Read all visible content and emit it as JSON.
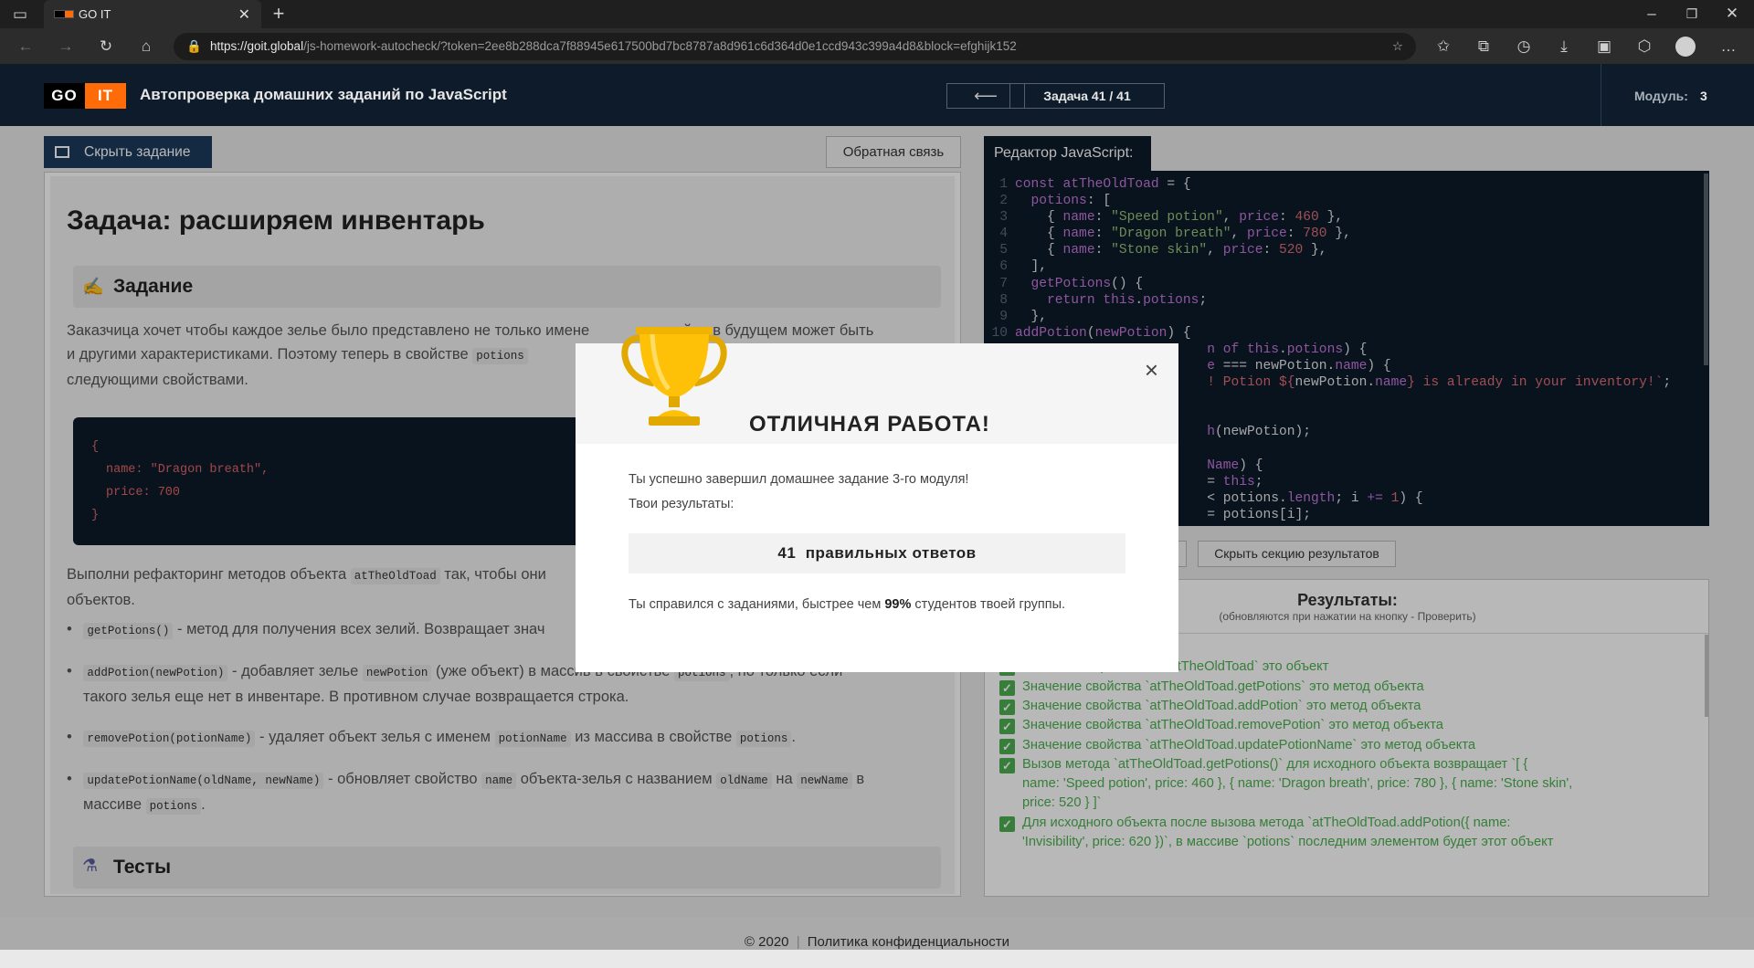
{
  "browser": {
    "tab_title": "GO IT",
    "url_host": "https://goit.global",
    "url_path": "/js-homework-autocheck/?token=2ee8b288dca7f88945e617500bd7bc8787a8d961c6d364d0e1ccd943c399a4d8&block=efghijk152"
  },
  "header": {
    "logo_go": "GO",
    "logo_it": "IT",
    "title": "Автопроверка домашних заданий по JavaScript",
    "back_arrow": "⟵",
    "task_counter": "Задача 41 / 41",
    "module_label": "Модуль:",
    "module_value": "3"
  },
  "toolbar": {
    "hide_task": "Скрыть задание",
    "feedback": "Обратная связь",
    "editor_title": "Редактор JavaScript:",
    "hide_results": "Скрыть секцию результатов"
  },
  "task": {
    "heading": "Задача: расширяем инвентарь",
    "section_assignment": "Задание",
    "p1_line1_a": "Заказчица хочет чтобы каждое зелье было представлено не только имене",
    "p1_line1_b": "ной, а в будущем может быть",
    "p1_line2": "и другими характеристиками. Поэтому теперь в свойстве",
    "p1_line2_code": "potions",
    "p1_line3": "следующими свойствами.",
    "code_open": "{",
    "code_name": "name: \"Dragon breath\",",
    "code_price": "price: 700",
    "code_close": "}",
    "p2_line1_a": "Выполни рефакторинг методов объекта",
    "p2_line1_code": "atTheOldToad",
    "p2_line1_b": "так, чтобы они",
    "p2_line2": "объектов.",
    "li1_code": "getPotions()",
    "li1_text": "- метод для получения всех зелий. Возвращает знач",
    "li2_code": "addPotion(newPotion)",
    "li2_text_a": "- добавляет зелье",
    "li2_code2": "newPotion",
    "li2_text_b": "(уже объект) в массив в свойстве",
    "li2_code3": "potions",
    "li2_text_c": ", но только если",
    "li2_line2": "такого зелья еще нет в инвентаре. В противном случае возвращается строка.",
    "li3_code": "removePotion(potionName)",
    "li3_text_a": "- удаляет объект зелья с именем",
    "li3_code2": "potionName",
    "li3_text_b": "из массива в свойстве",
    "li3_code3": "potions",
    "li3_text_c": ".",
    "li4_code": "updatePotionName(oldName, newName)",
    "li4_text_a": "- обновляет свойство",
    "li4_code2": "name",
    "li4_text_b": "объекта-зелья с названием",
    "li4_code3": "oldName",
    "li4_text_c": "на",
    "li4_code4": "newName",
    "li4_text_d": "в",
    "li4_line2_a": "массиве",
    "li4_line2_code": "potions",
    "li4_line2_b": ".",
    "section_tests": "Тесты"
  },
  "editor": {
    "lines": [
      {
        "n": "1",
        "parts": [
          [
            "kw",
            "const "
          ],
          [
            "nm",
            "atTheOldToad"
          ],
          [
            "txt",
            " = {"
          ]
        ]
      },
      {
        "n": "2",
        "parts": [
          [
            "pr",
            "  potions"
          ],
          [
            "txt",
            ": ["
          ]
        ]
      },
      {
        "n": "3",
        "parts": [
          [
            "txt",
            "    { "
          ],
          [
            "pr",
            "name"
          ],
          [
            "txt",
            ": "
          ],
          [
            "str",
            "\"Speed potion\""
          ],
          [
            "txt",
            ", "
          ],
          [
            "pr",
            "price"
          ],
          [
            "txt",
            ": "
          ],
          [
            "num",
            "460"
          ],
          [
            "txt",
            " },"
          ]
        ]
      },
      {
        "n": "4",
        "parts": [
          [
            "txt",
            "    { "
          ],
          [
            "pr",
            "name"
          ],
          [
            "txt",
            ": "
          ],
          [
            "str",
            "\"Dragon breath\""
          ],
          [
            "txt",
            ", "
          ],
          [
            "pr",
            "price"
          ],
          [
            "txt",
            ": "
          ],
          [
            "num",
            "780"
          ],
          [
            "txt",
            " },"
          ]
        ]
      },
      {
        "n": "5",
        "parts": [
          [
            "txt",
            "    { "
          ],
          [
            "pr",
            "name"
          ],
          [
            "txt",
            ": "
          ],
          [
            "str",
            "\"Stone skin\""
          ],
          [
            "txt",
            ", "
          ],
          [
            "pr",
            "price"
          ],
          [
            "txt",
            ": "
          ],
          [
            "num",
            "520"
          ],
          [
            "txt",
            " },"
          ]
        ]
      },
      {
        "n": "6",
        "parts": [
          [
            "txt",
            "  ],"
          ]
        ]
      },
      {
        "n": "7",
        "parts": [
          [
            "pr",
            "  getPotions"
          ],
          [
            "txt",
            "() {"
          ]
        ]
      },
      {
        "n": "8",
        "parts": [
          [
            "kw",
            "    return "
          ],
          [
            "kw",
            "this"
          ],
          [
            "txt",
            "."
          ],
          [
            "pr",
            "potions"
          ],
          [
            "txt",
            ";"
          ]
        ]
      },
      {
        "n": "9",
        "parts": [
          [
            "txt",
            "  },"
          ]
        ]
      },
      {
        "n": "10",
        "parts": [
          [
            "pr",
            "addPotion"
          ],
          [
            "txt",
            "("
          ],
          [
            "pr",
            "newPotion"
          ],
          [
            "txt",
            ") {"
          ]
        ]
      },
      {
        "n": "",
        "parts": [
          [
            "txt",
            "                        "
          ],
          [
            "kw",
            "n of "
          ],
          [
            "kw",
            "this"
          ],
          [
            "txt",
            "."
          ],
          [
            "pr",
            "potions"
          ],
          [
            "txt",
            ") {"
          ]
        ]
      },
      {
        "n": "",
        "parts": [
          [
            "txt",
            "                        "
          ],
          [
            "pr",
            "e"
          ],
          [
            "txt",
            " === newPotion."
          ],
          [
            "pr",
            "name"
          ],
          [
            "txt",
            ") {"
          ]
        ]
      },
      {
        "n": "",
        "parts": [
          [
            "txt",
            "                        "
          ],
          [
            "num",
            "! Potion ${"
          ],
          [
            "txt",
            "newPotion."
          ],
          [
            "pr",
            "name"
          ],
          [
            "num",
            "} is already in your inventory!`"
          ],
          [
            "txt",
            ";"
          ]
        ]
      },
      {
        "n": "",
        "parts": [
          [
            "txt",
            " "
          ]
        ]
      },
      {
        "n": "",
        "parts": [
          [
            "txt",
            " "
          ]
        ]
      },
      {
        "n": "",
        "parts": [
          [
            "txt",
            "                        "
          ],
          [
            "pr",
            "h"
          ],
          [
            "txt",
            "(newPotion);"
          ]
        ]
      },
      {
        "n": "",
        "parts": [
          [
            "txt",
            " "
          ]
        ]
      },
      {
        "n": "",
        "parts": [
          [
            "txt",
            "                        "
          ],
          [
            "pr",
            "Name"
          ],
          [
            "txt",
            ") {"
          ]
        ]
      },
      {
        "n": "",
        "parts": [
          [
            "txt",
            "                        "
          ],
          [
            "txt",
            "= "
          ],
          [
            "kw",
            "this"
          ],
          [
            "txt",
            ";"
          ]
        ]
      },
      {
        "n": "",
        "parts": [
          [
            "txt",
            "                        "
          ],
          [
            "txt",
            "< potions."
          ],
          [
            "pr",
            "length"
          ],
          [
            "txt",
            "; i "
          ],
          [
            "kw",
            "+="
          ],
          [
            "txt",
            " "
          ],
          [
            "num",
            "1"
          ],
          [
            "txt",
            ") {"
          ]
        ]
      },
      {
        "n": "",
        "parts": [
          [
            "txt",
            "                        "
          ],
          [
            "txt",
            "= potions[i];"
          ]
        ]
      }
    ]
  },
  "results": {
    "title": "Результаты:",
    "subtitle": "(обновляются при нажатии на кнопку - Проверить)",
    "items": [
      "я 'atTheOldToad'",
      "Значение переменной `atTheOldToad` это объект",
      "Значение свойства `atTheOldToad.getPotions` это метод объекта",
      "Значение свойства `atTheOldToad.addPotion` это метод объекта",
      "Значение свойства `atTheOldToad.removePotion` это метод объекта",
      "Значение свойства `atTheOldToad.updatePotionName` это метод объекта",
      "Вызов метода `atTheOldToad.getPotions()` для исходного объекта возвращает `[ {",
      "name: 'Speed potion', price: 460 }, { name: 'Dragon breath', price: 780 }, { name: 'Stone skin',",
      "price: 520 } ]`",
      "Для исходного объекта после вызова метода `atTheOldToad.addPotion({ name:",
      "'Invisibility', price: 620 })`, в массиве `potions` последним элементом будет этот объект"
    ]
  },
  "modal": {
    "title": "ОТЛИЧНАЯ РАБОТА!",
    "close": "×",
    "line1": "Ты успешно завершил домашнее задание 3-го модуля!",
    "line2": "Твои результаты:",
    "score_value": "41",
    "score_label": "правильных ответов",
    "faster_a": "Ты справился с заданиями, быстрее чем",
    "faster_pct": "99%",
    "faster_b": "студентов твоей группы."
  },
  "footer": {
    "copyright": "© 2020",
    "privacy": "Политика конфиденциальности"
  },
  "colors": {
    "navy": "#0d1b2a",
    "accent_orange": "#ff6b08",
    "success_green": "#4caf50",
    "button_blue": "#1d3a5c"
  }
}
